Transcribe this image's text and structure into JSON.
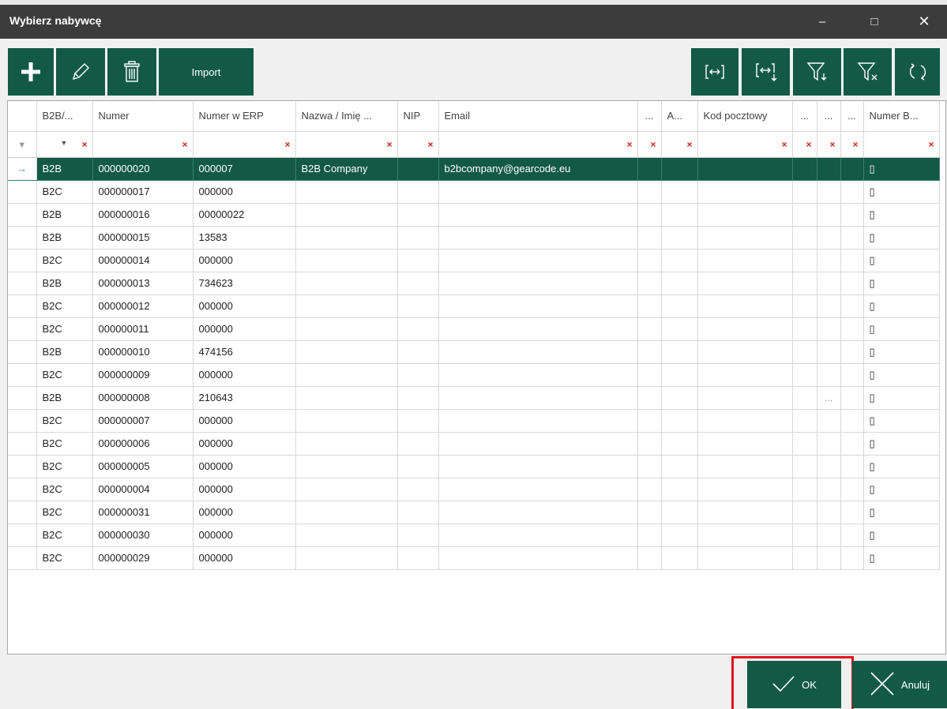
{
  "window": {
    "title": "Wybierz nabywcę",
    "minimize_glyph": "–",
    "maximize_glyph": "□",
    "close_glyph": "✕"
  },
  "toolbar": {
    "add_icon": "plus-icon",
    "edit_icon": "pencil-icon",
    "delete_icon": "trash-icon",
    "import_label": "Import",
    "fit_columns_icon": "fit-columns-icon",
    "fit_columns_down_icon": "fit-columns-down-icon",
    "filter_icon": "filter-add-icon",
    "clear_filter_icon": "filter-clear-icon",
    "refresh_icon": "refresh-icon"
  },
  "grid": {
    "columns": [
      "B2B/...",
      "Numer",
      "Numer w ERP",
      "Nazwa / Imię ...",
      "NIP",
      "Email",
      "...",
      "A...",
      "Kod pocztowy",
      "...",
      "...",
      "...",
      "Numer B..."
    ],
    "selected_marker": "→",
    "filter_marker": "▼",
    "filter_clear": "×",
    "checkbox_glyph": "▯",
    "rows": [
      [
        "B2B",
        "000000020",
        "000007",
        "B2B Company",
        "",
        "b2bcompany@gearcode.eu",
        "",
        "",
        "",
        "",
        "",
        "",
        "▯"
      ],
      [
        "B2C",
        "000000017",
        "000000",
        "",
        "",
        "",
        "",
        "",
        "",
        "",
        "",
        "",
        "▯"
      ],
      [
        "B2B",
        "000000016",
        "00000022",
        "",
        "",
        "",
        "",
        "",
        "",
        "",
        "",
        "",
        "▯"
      ],
      [
        "B2B",
        "000000015",
        "13583",
        "",
        "",
        "",
        "",
        "",
        "",
        "",
        "",
        "",
        "▯"
      ],
      [
        "B2C",
        "000000014",
        "000000",
        "",
        "",
        "",
        "",
        "",
        "",
        "",
        "",
        "",
        "▯"
      ],
      [
        "B2B",
        "000000013",
        "734623",
        "",
        "",
        "",
        "",
        "",
        "",
        "",
        "",
        "",
        "▯"
      ],
      [
        "B2C",
        "000000012",
        "000000",
        "",
        "",
        "",
        "",
        "",
        "",
        "",
        "",
        "",
        "▯"
      ],
      [
        "B2C",
        "000000011",
        "000000",
        "",
        "",
        "",
        "",
        "",
        "",
        "",
        "",
        "",
        "▯"
      ],
      [
        "B2B",
        "000000010",
        "474156",
        "",
        "",
        "",
        "",
        "",
        "",
        "",
        "",
        "",
        "▯"
      ],
      [
        "B2C",
        "000000009",
        "000000",
        "",
        "",
        "",
        "",
        "",
        "",
        "",
        "",
        "",
        "▯"
      ],
      [
        "B2B",
        "000000008",
        "210643",
        "",
        "",
        "",
        "",
        "",
        "",
        "",
        "...",
        "",
        "▯"
      ],
      [
        "B2C",
        "000000007",
        "000000",
        "",
        "",
        "",
        "",
        "",
        "",
        "",
        "",
        "",
        "▯"
      ],
      [
        "B2C",
        "000000006",
        "000000",
        "",
        "",
        "",
        "",
        "",
        "",
        "",
        "",
        "",
        "▯"
      ],
      [
        "B2C",
        "000000005",
        "000000",
        "",
        "",
        "",
        "",
        "",
        "",
        "",
        "",
        "",
        "▯"
      ],
      [
        "B2C",
        "000000004",
        "000000",
        "",
        "",
        "",
        "",
        "",
        "",
        "",
        "",
        "",
        "▯"
      ],
      [
        "B2C",
        "000000031",
        "000000",
        "",
        "",
        "",
        "",
        "",
        "",
        "",
        "",
        "",
        "▯"
      ],
      [
        "B2C",
        "000000030",
        "000000",
        "",
        "",
        "",
        "",
        "",
        "",
        "",
        "",
        "",
        "▯"
      ],
      [
        "B2C",
        "000000029",
        "000000",
        "",
        "",
        "",
        "",
        "",
        "",
        "",
        "",
        "",
        "▯"
      ]
    ]
  },
  "footer": {
    "ok_label": "OK",
    "cancel_label": "Anuluj"
  },
  "colors": {
    "accent": "#135a46",
    "titlebar": "#3c3c3c",
    "highlight_frame": "#e4101b",
    "filter_clear": "#d32020"
  }
}
